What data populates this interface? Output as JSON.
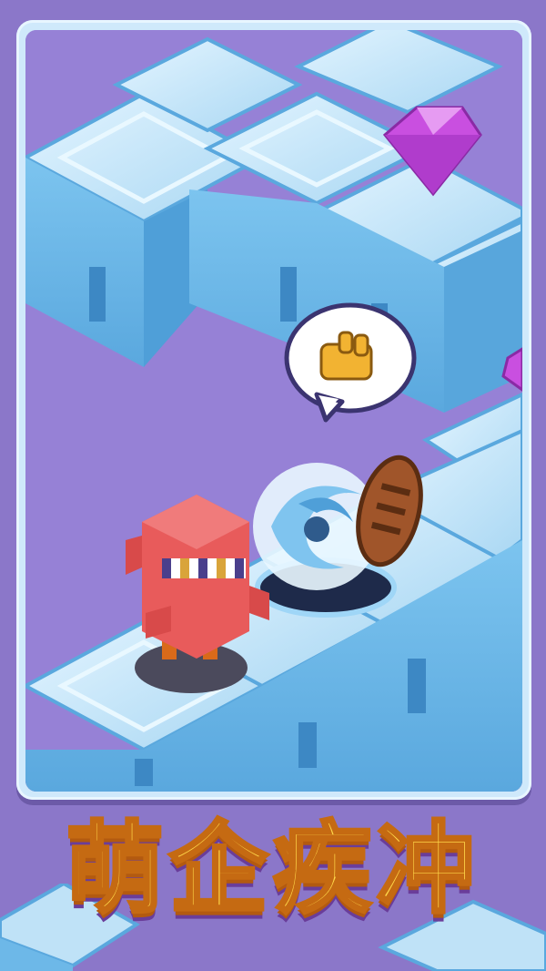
{
  "game": {
    "title": "萌企疾冲",
    "colors": {
      "background": "#8b77c9",
      "ice_top": "#bfe2f7",
      "ice_side": "#6db8e8",
      "gem": "#c94fe0",
      "character": "#e85b5b",
      "title_fill": "#ffd84a"
    },
    "icons": [
      "gem-icon",
      "speech-bubble-icon",
      "hand-icon",
      "vortex-icon",
      "wooden-shield-icon",
      "character-icon"
    ]
  }
}
